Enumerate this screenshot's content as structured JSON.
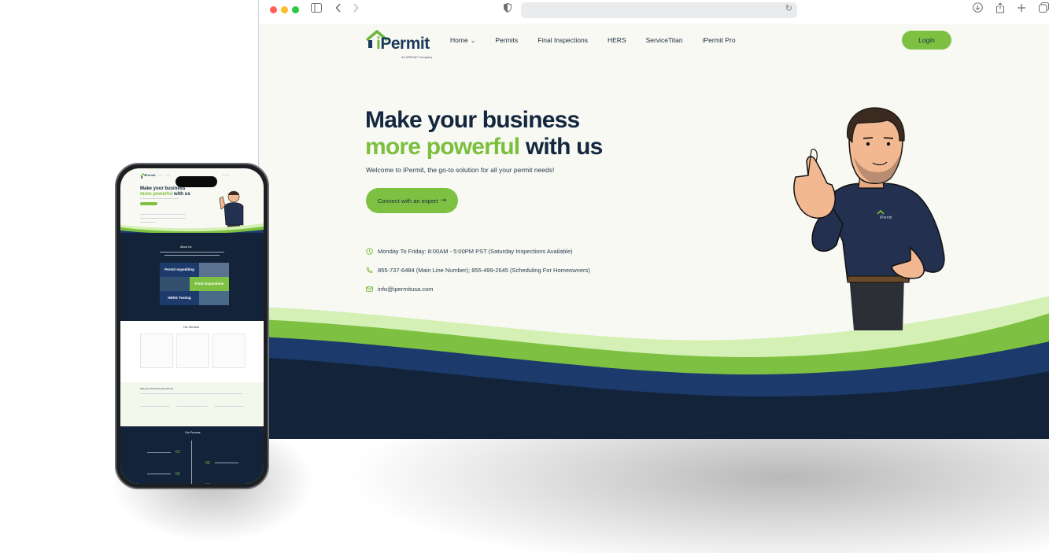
{
  "browser": {
    "traffic_lights": [
      "#ff5f57",
      "#febc2e",
      "#28c840"
    ],
    "icons": [
      "sidebar-icon",
      "back-icon",
      "forward-icon",
      "shield-icon",
      "reload-icon",
      "download-icon",
      "share-icon",
      "new-tab-icon",
      "tabs-icon"
    ],
    "address": ""
  },
  "site": {
    "logo": {
      "text_i": "i",
      "text_rest": "Permit",
      "tagline": "An ARENA* Company"
    },
    "nav": [
      {
        "label": "Home"
      },
      {
        "label": "Permits"
      },
      {
        "label": "Final Inspections"
      },
      {
        "label": "HERS"
      },
      {
        "label": "ServiceTitan"
      },
      {
        "label": "iPermit Pro"
      }
    ],
    "login_label": "Login",
    "hero": {
      "line1": "Make your business",
      "line2_green": "more powerful",
      "line2_rest": " with us",
      "subtitle": "Welcome to iPermit, the go-to solution for all your permit needs!",
      "cta": "Connect with an expert"
    },
    "info": {
      "hours": "Monday To Friday: 8:00AM - 5:00PM PST (Saturday Inspections Available)",
      "phone": "855-737-6484 (Main Line Number); 855-499-2645 (Scheduling For Homeowners)",
      "email": "info@ipermitusa.com"
    },
    "colors": {
      "green": "#7ec142",
      "navy": "#13273f",
      "wave_light": "#d4f0b4",
      "wave_blue": "#1c3a6b",
      "wave_dark": "#13243a"
    }
  },
  "phone": {
    "logo": "iPermit",
    "hero_line1": "Make your business",
    "hero_line2_green": "more powerful",
    "hero_line2_rest": " with us",
    "about_title": "About Us",
    "tiles": [
      "Permit expediting",
      "Final Inspections",
      "HERS Testing"
    ],
    "services_title": "Our Services",
    "why_title": "Why you should choose iPermit",
    "process_title": "Our Process",
    "steps": [
      "01",
      "02",
      "03",
      "04"
    ]
  }
}
